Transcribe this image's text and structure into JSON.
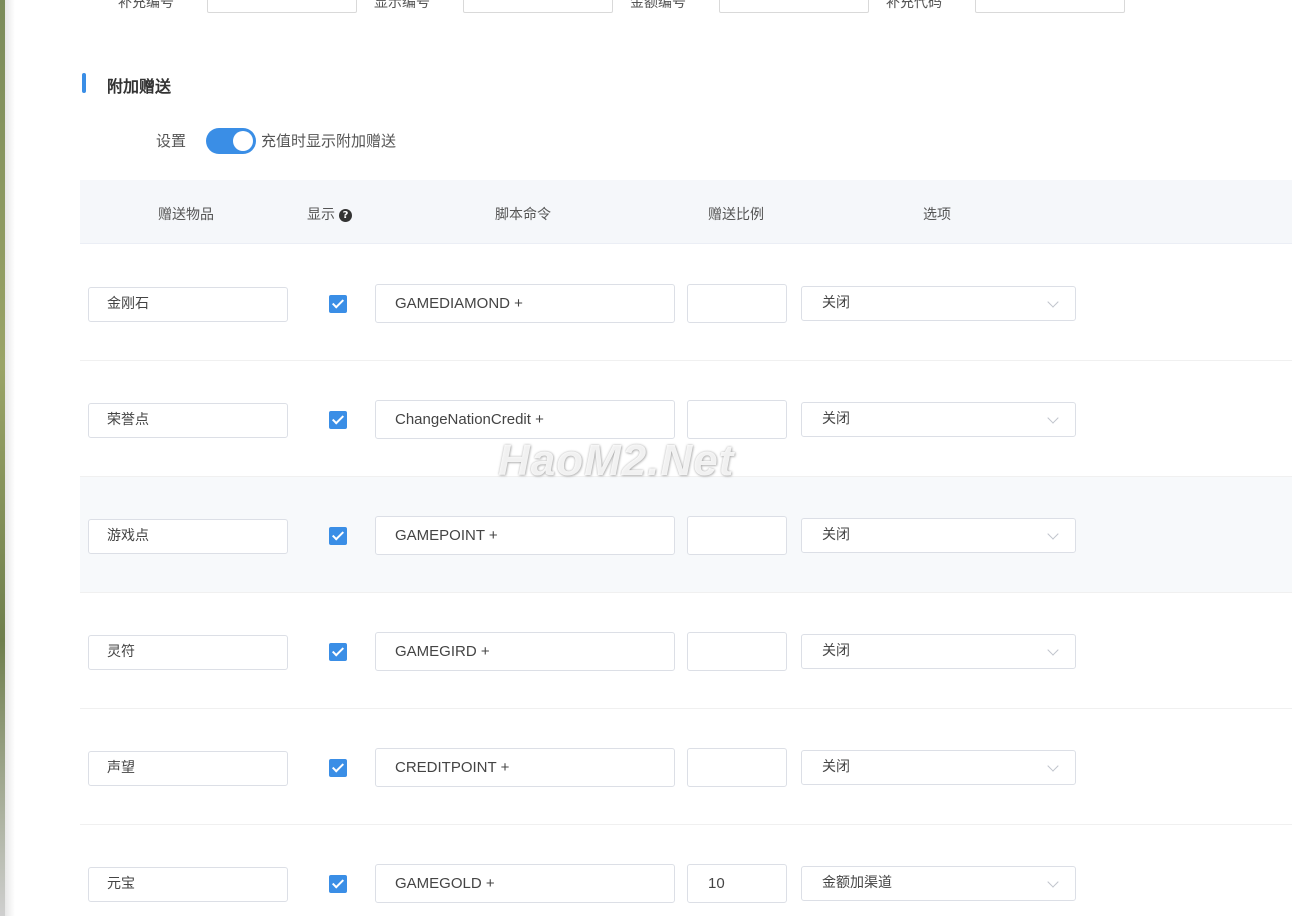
{
  "top_filters": {
    "labels": [
      "补充编号",
      "显示编号",
      "金额编号",
      "补充代码"
    ]
  },
  "section": {
    "title": "附加赠送"
  },
  "settings": {
    "label": "设置",
    "toggle_on": true,
    "toggle_text": "充值时显示附加赠送"
  },
  "table": {
    "headers": {
      "item": "赠送物品",
      "show": "显示",
      "script": "脚本命令",
      "ratio": "赠送比例",
      "option": "选项"
    },
    "rows": [
      {
        "item": "金刚石",
        "show": true,
        "script": "GAMEDIAMOND +",
        "ratio": "",
        "option": "关闭"
      },
      {
        "item": "荣誉点",
        "show": true,
        "script": "ChangeNationCredit +",
        "ratio": "",
        "option": "关闭"
      },
      {
        "item": "游戏点",
        "show": true,
        "script": "GAMEPOINT +",
        "ratio": "",
        "option": "关闭"
      },
      {
        "item": "灵符",
        "show": true,
        "script": "GAMEGIRD +",
        "ratio": "",
        "option": "关闭"
      },
      {
        "item": "声望",
        "show": true,
        "script": "CREDITPOINT +",
        "ratio": "",
        "option": "关闭"
      },
      {
        "item": "元宝",
        "show": true,
        "script": "GAMEGOLD +",
        "ratio": "10",
        "option": "金额加渠道"
      }
    ]
  },
  "watermark": "HaoM2.Net",
  "colors": {
    "accent": "#3a8ee6",
    "header_bg": "#f5f7fa",
    "stripe_bg": "#f7f9fb"
  }
}
